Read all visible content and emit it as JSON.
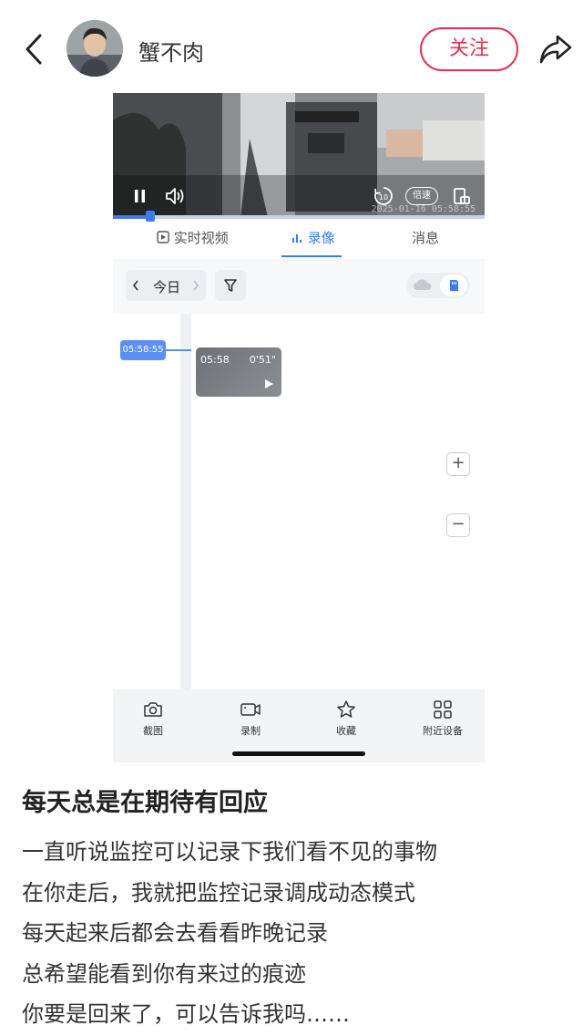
{
  "header": {
    "username": "蟹不肉",
    "follow_label": "关注"
  },
  "player": {
    "timestamp": "2025-01-16 05:58:55",
    "speed_label": "倍速",
    "progress_fraction": 0.1
  },
  "tabs": [
    {
      "label": "实时视频",
      "active": false
    },
    {
      "label": "录像",
      "active": true
    },
    {
      "label": "消息",
      "active": false
    }
  ],
  "filter": {
    "day_label": "今日"
  },
  "timeline": {
    "current_time": "05:58:55",
    "clip": {
      "start": "05:58",
      "duration": "0'51\""
    }
  },
  "bottom_bar": [
    {
      "label": "截图",
      "icon": "camera-icon"
    },
    {
      "label": "录制",
      "icon": "video-record-icon"
    },
    {
      "label": "收藏",
      "icon": "star-icon"
    },
    {
      "label": "附近设备",
      "icon": "grid-icon"
    }
  ],
  "post": {
    "title": "每天总是在期待有回应",
    "lines": [
      "一直听说监控可以记录下我们看不见的事物",
      "在你走后，我就把监控记录调成动态模式",
      "每天起来后都会去看看昨晚记录",
      "总希望能看到你有来过的痕迹",
      "你要是回来了，可以告诉我吗……"
    ]
  },
  "colors": {
    "accent_red": "#e0334f",
    "accent_blue": "#3d7cf0"
  }
}
